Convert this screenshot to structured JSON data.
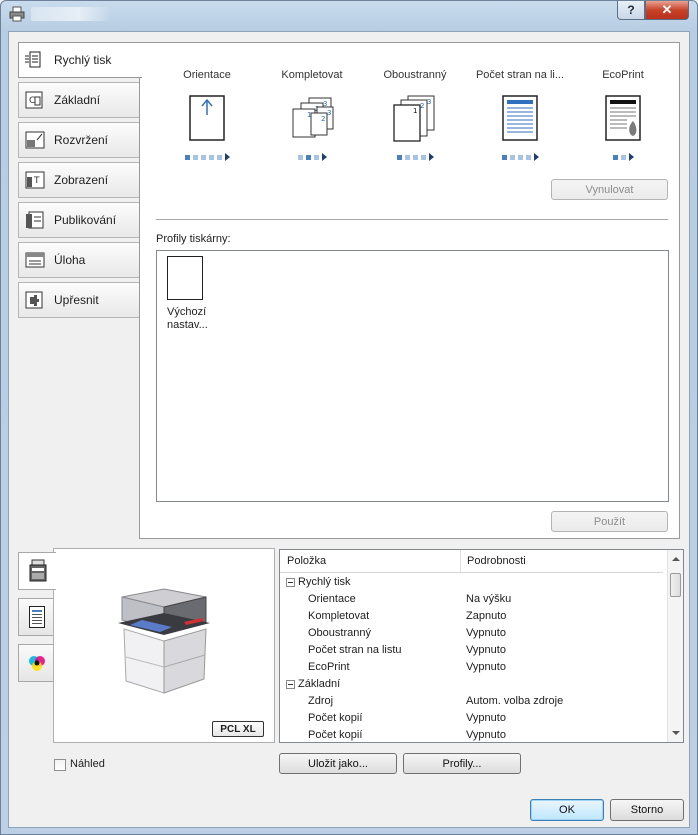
{
  "window": {
    "title": "",
    "help_label": "?",
    "close_label": "✕"
  },
  "tabs": [
    {
      "label": "Rychlý tisk",
      "icon": "quick-print-icon"
    },
    {
      "label": "Základní",
      "icon": "basic-icon"
    },
    {
      "label": "Rozvržení",
      "icon": "layout-icon"
    },
    {
      "label": "Zobrazení",
      "icon": "imaging-icon"
    },
    {
      "label": "Publikování",
      "icon": "publishing-icon"
    },
    {
      "label": "Úloha",
      "icon": "job-icon"
    },
    {
      "label": "Upřesnit",
      "icon": "advanced-icon"
    }
  ],
  "quick_print": {
    "columns": [
      {
        "label": "Orientace",
        "steps_total": 5,
        "steps_active": 1
      },
      {
        "label": "Kompletovat",
        "steps_total": 3,
        "steps_active": 2
      },
      {
        "label": "Oboustranný",
        "steps_total": 4,
        "steps_active": 1
      },
      {
        "label": "Počet stran na li...",
        "steps_total": 4,
        "steps_active": 1
      },
      {
        "label": "EcoPrint",
        "steps_total": 2,
        "steps_active": 1
      }
    ],
    "reset_label": "Vynulovat",
    "profiles_label": "Profily tiskárny:",
    "profiles": [
      {
        "name": "Výchozí nastav..."
      }
    ],
    "apply_label": "Použít"
  },
  "details": {
    "col_item": "Položka",
    "col_details": "Podrobnosti",
    "rows": [
      {
        "key": "Rychlý tisk",
        "value": "",
        "group": true
      },
      {
        "key": "Orientace",
        "value": "Na výšku",
        "group": false
      },
      {
        "key": "Kompletovat",
        "value": "Zapnuto",
        "group": false
      },
      {
        "key": "Oboustranný",
        "value": "Vypnuto",
        "group": false
      },
      {
        "key": "Počet stran na listu",
        "value": "Vypnuto",
        "group": false
      },
      {
        "key": "EcoPrint",
        "value": "Vypnuto",
        "group": false
      },
      {
        "key": "Základní",
        "value": "",
        "group": true
      },
      {
        "key": "Zdroj",
        "value": "Autom. volba zdroje",
        "group": false
      },
      {
        "key": "Počet kopií",
        "value": "Vypnuto",
        "group": false
      },
      {
        "key": "Počet kopií",
        "value": "Vypnuto",
        "group": false
      }
    ]
  },
  "preview": {
    "badge": "PCL XL",
    "preview_checkbox_label": "Náhled",
    "preview_checked": false
  },
  "buttons": {
    "save_as": "Uložit jako...",
    "profiles": "Profily...",
    "ok": "OK",
    "cancel": "Storno"
  },
  "colors": {
    "accent_blue": "#4a7fc0",
    "dot_light": "#a9c3e4"
  }
}
